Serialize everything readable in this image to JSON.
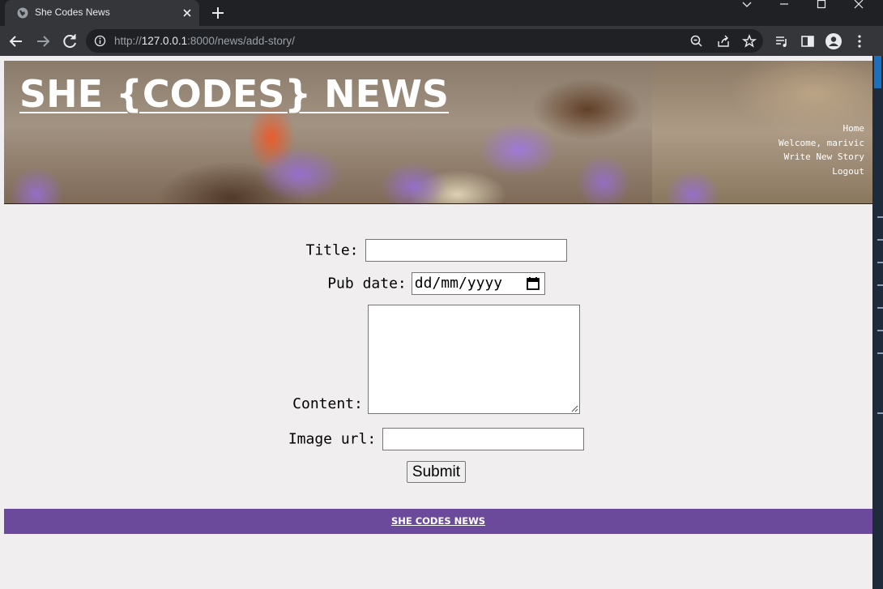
{
  "browser": {
    "tab_title": "She Codes News",
    "url_prefix": "http://",
    "url_host": "127.0.0.1",
    "url_rest": ":8000/news/add-story/"
  },
  "header": {
    "site_title": "SHE {CODES} NEWS",
    "nav": [
      "Home",
      "Welcome, marivic",
      "Write New Story",
      "Logout"
    ]
  },
  "form": {
    "title_label": "Title:",
    "title_value": "",
    "pub_date_label": "Pub date:",
    "pub_date_placeholder": "dd/mm/yyyy",
    "content_label": "Content:",
    "content_value": "",
    "image_url_label": "Image url:",
    "image_url_value": "",
    "submit_label": "Submit"
  },
  "footer": {
    "text": "SHE CODES NEWS"
  },
  "colors": {
    "footer_bg": "#6b4a9b",
    "page_bg": "#f0eeee"
  },
  "icons": [
    "globe-favicon-icon",
    "close-icon",
    "plus-icon",
    "chevron-down-icon",
    "minimize-icon",
    "maximize-icon",
    "window-close-icon",
    "back-arrow-icon",
    "forward-arrow-icon",
    "reload-icon",
    "info-icon",
    "zoom-icon",
    "share-icon",
    "star-icon",
    "media-queue-icon",
    "side-panel-icon",
    "profile-icon",
    "kebab-menu-icon",
    "calendar-icon"
  ]
}
